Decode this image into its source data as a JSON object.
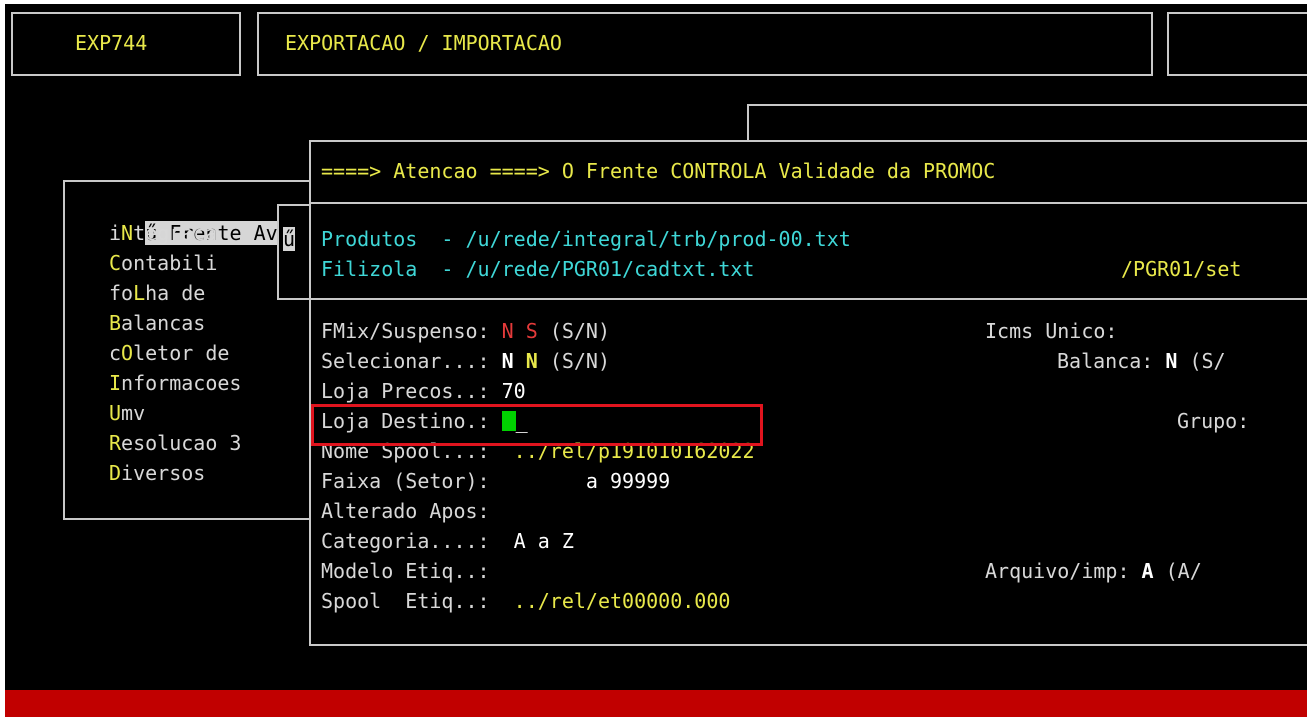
{
  "header": {
    "code": "EXP744",
    "title": "EXPORTACAO / IMPORTACAO"
  },
  "menu": {
    "selected_marker": "ű",
    "items": [
      {
        "hot": "",
        "rest": "Frente Av",
        "selected": true
      },
      {
        "hot": "",
        "pre": "i",
        "hotmid": "N",
        "rest": "tegraca"
      },
      {
        "hot": "C",
        "rest": "ontabili"
      },
      {
        "pre": "fo",
        "hotmid": "L",
        "rest": "ha de"
      },
      {
        "hot": "B",
        "rest": "alancas"
      },
      {
        "pre": "c",
        "hotmid": "O",
        "rest": "letor de"
      },
      {
        "hot": "I",
        "rest": "nformacoes"
      },
      {
        "hot": "U",
        "rest": "mv"
      },
      {
        "hot": "R",
        "rest": "esolucao 3"
      },
      {
        "hot": "D",
        "rest": "iversos"
      }
    ],
    "submenu_marker": "ű"
  },
  "dialog": {
    "warning": "====> Atencao ====> O Frente CONTROLA Validade da PROMOC",
    "produtos_label": "Produtos  - /u/rede/integral/trb/prod-00.txt",
    "filizola_label": "Filizola  - /u/rede/PGR01/cadtxt.txt",
    "filizola_right": "/PGR01/set",
    "fields": {
      "fmix_label": "FMix/Suspenso:",
      "fmix_v1": "N",
      "fmix_v2": "S",
      "fmix_hint": "(S/N)",
      "sel_label": "Selecionar...:",
      "sel_v1": "N",
      "sel_v2": "N",
      "sel_hint": "(S/N)",
      "loja_precos_label": "Loja Precos..:",
      "loja_precos_value": "70",
      "loja_destino_label": "Loja Destino.:",
      "loja_destino_value": "_",
      "nome_spool_label": "Nome Spool...:",
      "nome_spool_value": "../rel/p191010162022",
      "faixa_label": "Faixa (Setor):",
      "faixa_value": "a 99999",
      "alterado_label": "Alterado Apos:",
      "categoria_label": "Categoria....:",
      "categoria_value": "A a Z",
      "modelo_label": "Modelo Etiq..:",
      "spool_label": "Spool  Etiq..:",
      "spool_value": "../rel/et00000.000",
      "icms_label": "Icms Unico:",
      "balanca_label": "Balanca:",
      "balanca_value": "N",
      "balanca_hint": "(S/",
      "grupo_label": "Grupo:",
      "arquivo_label": "Arquivo/imp:",
      "arquivo_value": "A",
      "arquivo_hint": "(A/"
    }
  },
  "colors": {
    "background": "#000000",
    "border": "#c9c9c9",
    "yellow": "#e8e84a",
    "cyan": "#3fd7d7",
    "red": "#e43a3a",
    "status_bar": "#c10000",
    "cursor": "#00d200",
    "annotation": "#e0141e"
  }
}
